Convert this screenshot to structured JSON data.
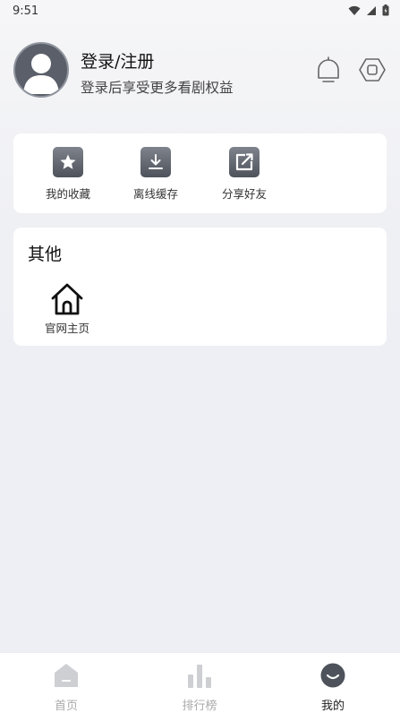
{
  "status_bar": {
    "time": "9:51"
  },
  "user": {
    "title": "登录/注册",
    "subtitle": "登录后享受更多看剧权益"
  },
  "quick_actions": [
    {
      "label": "我的收藏",
      "icon": "star-icon"
    },
    {
      "label": "离线缓存",
      "icon": "download-icon"
    },
    {
      "label": "分享好友",
      "icon": "share-icon"
    }
  ],
  "other": {
    "title": "其他",
    "items": [
      {
        "label": "官网主页",
        "icon": "home-icon"
      }
    ]
  },
  "bottom_nav": [
    {
      "label": "首页",
      "icon": "home-tab-icon",
      "active": false
    },
    {
      "label": "排行榜",
      "icon": "bar-chart-icon",
      "active": false
    },
    {
      "label": "我的",
      "icon": "profile-tab-icon",
      "active": true
    }
  ],
  "colors": {
    "background": "#edeff4",
    "card": "#ffffff",
    "icon_dark": "#5a5f6a",
    "nav_inactive": "#aaaaaa"
  }
}
